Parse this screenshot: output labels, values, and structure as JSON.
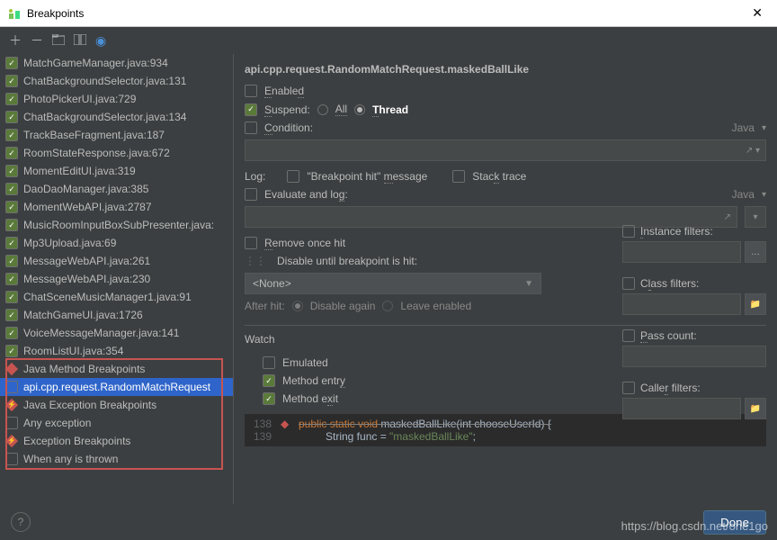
{
  "window": {
    "title": "Breakpoints"
  },
  "breakpoints": [
    {
      "label": "MatchGameManager.java:934",
      "checked": true,
      "kind": "line"
    },
    {
      "label": "ChatBackgroundSelector.java:131",
      "checked": true,
      "kind": "line"
    },
    {
      "label": "PhotoPickerUI.java:729",
      "checked": true,
      "kind": "line"
    },
    {
      "label": "ChatBackgroundSelector.java:134",
      "checked": true,
      "kind": "line"
    },
    {
      "label": "TrackBaseFragment.java:187",
      "checked": true,
      "kind": "line"
    },
    {
      "label": "RoomStateResponse.java:672",
      "checked": true,
      "kind": "line"
    },
    {
      "label": "MomentEditUI.java:319",
      "checked": true,
      "kind": "line"
    },
    {
      "label": "DaoDaoManager.java:385",
      "checked": true,
      "kind": "line"
    },
    {
      "label": "MomentWebAPI.java:2787",
      "checked": true,
      "kind": "line"
    },
    {
      "label": "MusicRoomInputBoxSubPresenter.java:",
      "checked": true,
      "kind": "line"
    },
    {
      "label": "Mp3Upload.java:69",
      "checked": true,
      "kind": "line"
    },
    {
      "label": "MessageWebAPI.java:261",
      "checked": true,
      "kind": "line"
    },
    {
      "label": "MessageWebAPI.java:230",
      "checked": true,
      "kind": "line"
    },
    {
      "label": "ChatSceneMusicManager1.java:91",
      "checked": true,
      "kind": "line"
    },
    {
      "label": "MatchGameUI.java:1726",
      "checked": true,
      "kind": "line"
    },
    {
      "label": "VoiceMessageManager.java:141",
      "checked": true,
      "kind": "line"
    },
    {
      "label": "RoomListUI.java:354",
      "checked": true,
      "kind": "line"
    },
    {
      "label": "Java Method Breakpoints",
      "kind": "category-method"
    },
    {
      "label": "api.cpp.request.RandomMatchRequest",
      "checked": false,
      "kind": "method",
      "selected": true
    },
    {
      "label": "Java Exception Breakpoints",
      "kind": "category-exception"
    },
    {
      "label": "Any exception",
      "checked": false,
      "kind": "exception"
    },
    {
      "label": "Exception Breakpoints",
      "kind": "category-exception"
    },
    {
      "label": "When any is thrown",
      "checked": false,
      "kind": "exception"
    }
  ],
  "detail": {
    "title": "api.cpp.request.RandomMatchRequest.maskedBallLike",
    "enabled": {
      "label": "Enabled",
      "checked": false
    },
    "suspend": {
      "label": "Suspend:",
      "checked": true,
      "all": "All",
      "thread": "Thread",
      "selected": "thread"
    },
    "condition": {
      "label": "Condition:",
      "checked": false,
      "lang": "Java"
    },
    "log": {
      "label": "Log:",
      "bp_hit": "\"Breakpoint hit\" message",
      "stack": "Stack trace"
    },
    "eval": {
      "label": "Evaluate and log:",
      "checked": false,
      "lang": "Java"
    },
    "remove": {
      "label": "Remove once hit",
      "checked": false
    },
    "disable_until": {
      "label": "Disable until breakpoint is hit:",
      "value": "<None>"
    },
    "after_hit": {
      "label": "After hit:",
      "disable_again": "Disable again",
      "leave": "Leave enabled"
    },
    "side": {
      "instance": "Instance filters:",
      "class": "Class filters:",
      "pass": "Pass count:",
      "caller": "Caller filters:"
    },
    "watch": {
      "title": "Watch",
      "emulated": "Emulated",
      "entry": "Method entry",
      "exit": "Method exit"
    }
  },
  "code": {
    "l1": {
      "num": "138",
      "text_kw": "public static void",
      "text_id": " maskedBallLike",
      "text_rest": "(int chooseUserId) {"
    },
    "l2": {
      "num": "139",
      "text": "String func = ",
      "str": "\"maskedBallLike\"",
      "end": ";"
    }
  },
  "footer": {
    "done": "Done"
  },
  "watermark": "https://blog.csdn.net/one1go"
}
